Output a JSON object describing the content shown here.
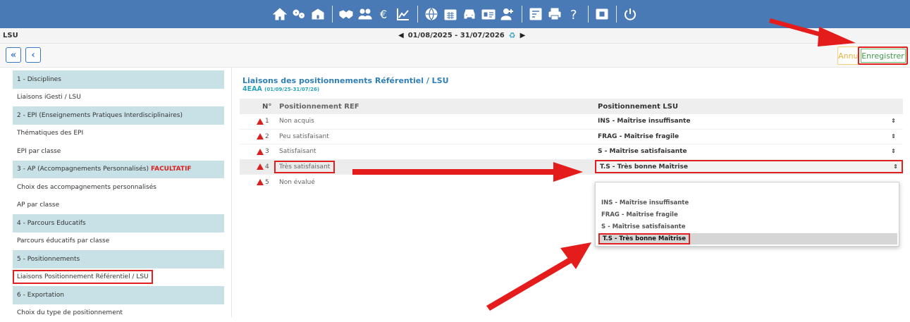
{
  "app": {
    "name": "LSU"
  },
  "period": {
    "label": "01/08/2025 - 31/07/2026",
    "prev_icon": "triangle-left-icon",
    "next_icon": "triangle-right-icon",
    "refresh_icon": "refresh-icon"
  },
  "topbar": {
    "groups": [
      [
        "home-icon",
        "cogs-icon",
        "school-icon"
      ],
      [
        "handshake-icon",
        "users-icon",
        "euro-icon",
        "chart-line-icon"
      ],
      [
        "globe-icon",
        "calendar-icon",
        "car-icon",
        "id-card-icon",
        "user-add-icon"
      ],
      [
        "report-icon",
        "print-icon",
        "help-icon"
      ],
      [
        "fullscreen-icon"
      ],
      [
        "power-icon"
      ]
    ]
  },
  "toolbar": {
    "first_label": "«",
    "back_label": "‹",
    "cancel_label": "Annuler",
    "save_label": "Enregistrer"
  },
  "sidebar": {
    "items": [
      {
        "label": "1 - Disciplines",
        "section": true
      },
      {
        "label": "Liaisons iGesti / LSU",
        "section": false
      },
      {
        "label": "2 - EPI (Enseignements Pratiques Interdisciplinaires)",
        "section": true
      },
      {
        "label": "Thématiques des EPI",
        "section": false
      },
      {
        "label": "EPI par classe",
        "section": false
      },
      {
        "label": "3 - AP (Accompagnements Personnalisés)",
        "section": true,
        "extra": "FACULTATIF"
      },
      {
        "label": "Choix des accompagnements personnalisés",
        "section": false
      },
      {
        "label": "AP par classe",
        "section": false
      },
      {
        "label": "4 - Parcours Educatifs",
        "section": true
      },
      {
        "label": "Parcours éducatifs par classe",
        "section": false
      },
      {
        "label": "5 - Positionnements",
        "section": true
      },
      {
        "label": "Liaisons Positionnement Référentiel / LSU",
        "section": false,
        "selected": true
      },
      {
        "label": "6 - Exportation",
        "section": true
      },
      {
        "label": "Choix du type de positionnement",
        "section": false
      }
    ]
  },
  "main": {
    "title": "Liaisons des positionnements Référentiel / LSU",
    "class_code": "4EAA",
    "class_dates": "(01/09/25-31/07/26)",
    "columns": [
      "N°",
      "Positionnement REF",
      "Positionnement LSU"
    ],
    "rows": [
      {
        "num": "1",
        "ref": "Non acquis",
        "lsu": "INS - Maîtrise insuffisante"
      },
      {
        "num": "2",
        "ref": "Peu satisfaisant",
        "lsu": "FRAG - Maîtrise fragile"
      },
      {
        "num": "3",
        "ref": "Satisfaisant",
        "lsu": "S - Maîtrise satisfaisante"
      },
      {
        "num": "4",
        "ref": "Très satisfaisant",
        "lsu": "T.S - Très bonne Maîtrise"
      },
      {
        "num": "5",
        "ref": "Non évalué",
        "lsu": ""
      }
    ],
    "select_arrow": "⇕"
  },
  "dropdown": {
    "options": [
      "INS - Maîtrise insuffisante",
      "FRAG - Maîtrise fragile",
      "S - Maîtrise satisfaisante",
      "T.S - Très bonne Maîtrise"
    ],
    "selected": "T.S - Très bonne Maîtrise"
  },
  "colors": {
    "topbar": "#4a7ab5",
    "section": "#c8e1e6",
    "accent_red": "#e02020",
    "title_blue": "#2f7fb8",
    "save_green": "#3f9a48",
    "warning": "#d8201e"
  }
}
